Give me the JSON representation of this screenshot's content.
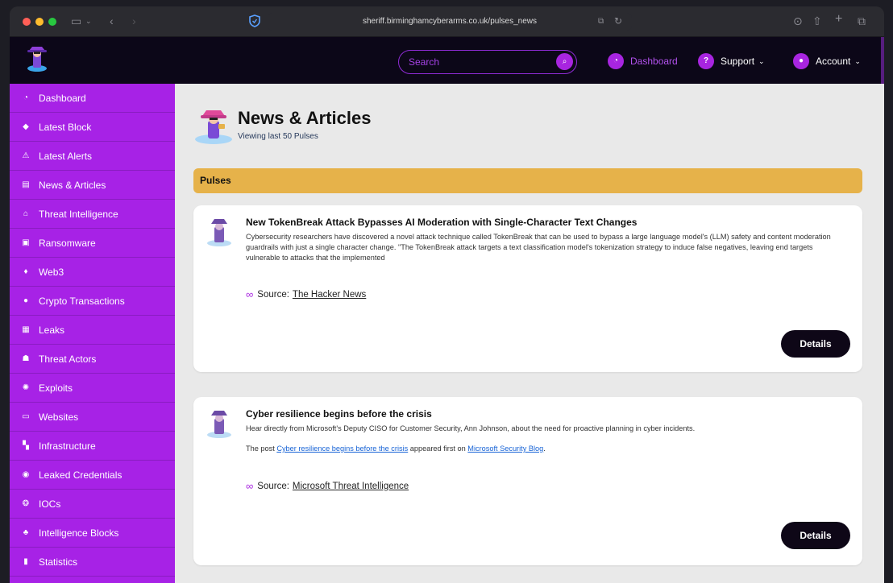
{
  "browser": {
    "url": "sheriff.birminghamcyberarms.co.uk/pulses_news"
  },
  "header": {
    "search": {
      "placeholder": "Search"
    },
    "nav": [
      {
        "label": "Dashboard",
        "icon": "dashboard-icon"
      },
      {
        "label": "Support",
        "icon": "help-icon"
      },
      {
        "label": "Account",
        "icon": "user-icon"
      }
    ]
  },
  "sidebar": {
    "items": [
      {
        "label": "Dashboard",
        "icon": "dashboard-icon"
      },
      {
        "label": "Latest Block",
        "icon": "cube-icon"
      },
      {
        "label": "Latest Alerts",
        "icon": "broadcast-icon"
      },
      {
        "label": "News & Articles",
        "icon": "newspaper-icon"
      },
      {
        "label": "Threat Intelligence",
        "icon": "landmark-icon"
      },
      {
        "label": "Ransomware",
        "icon": "lock-icon"
      },
      {
        "label": "Web3",
        "icon": "ethereum-icon"
      },
      {
        "label": "Crypto Transactions",
        "icon": "coin-icon"
      },
      {
        "label": "Leaks",
        "icon": "database-icon"
      },
      {
        "label": "Threat Actors",
        "icon": "spy-icon"
      },
      {
        "label": "Exploits",
        "icon": "virus-icon"
      },
      {
        "label": "Websites",
        "icon": "laptop-icon"
      },
      {
        "label": "Infrastructure",
        "icon": "network-icon"
      },
      {
        "label": "Leaked Credentials",
        "icon": "eye-icon"
      },
      {
        "label": "IOCs",
        "icon": "fingerprint-icon"
      },
      {
        "label": "Intelligence Blocks",
        "icon": "cubes-icon"
      },
      {
        "label": "Statistics",
        "icon": "bar-chart-icon"
      }
    ]
  },
  "page": {
    "title": "News & Articles",
    "subtitle": "Viewing last 50 Pulses",
    "section": "Pulses"
  },
  "cards": [
    {
      "title": "New TokenBreak Attack Bypasses AI Moderation with Single-Character Text Changes",
      "description": "Cybersecurity researchers have discovered a novel attack technique called TokenBreak that can be used to bypass a large language model's (LLM) safety and content moderation guardrails with just a single character change. \"The TokenBreak attack targets a text classification model's tokenization strategy to induce false negatives, leaving end targets vulnerable to attacks that the implemented",
      "source_label": "Source:",
      "source": "The Hacker News",
      "button": "Details"
    },
    {
      "title": "Cyber resilience begins before the crisis",
      "description": "Hear directly from Microsoft's Deputy CISO for Customer Security, Ann Johnson, about the need for proactive planning in cyber incidents.",
      "post_prefix": "The post",
      "post_link": "Cyber resilience begins before the crisis",
      "post_middle": "appeared first on",
      "post_blog": "Microsoft Security Blog",
      "post_suffix": ".",
      "source_label": "Source:",
      "source": "Microsoft Threat Intelligence",
      "button": "Details"
    }
  ],
  "colors": {
    "accent": "#a722e6",
    "header_bg": "#0c0718",
    "section_bar": "#e6b24a",
    "button_bg": "#0e0717"
  }
}
